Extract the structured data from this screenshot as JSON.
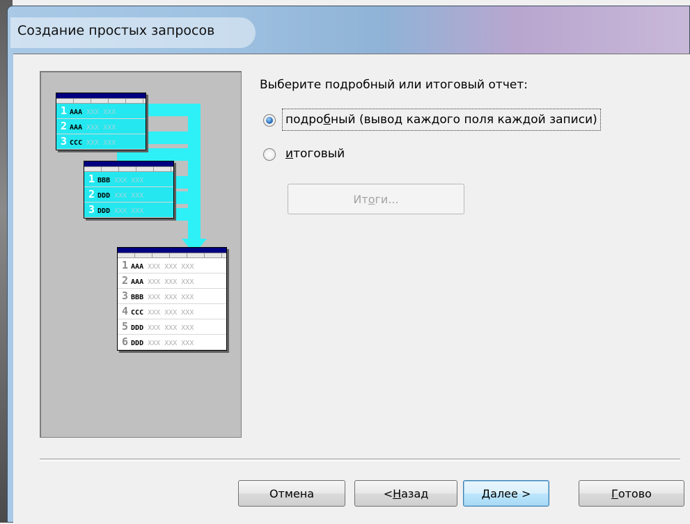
{
  "window": {
    "title": "Создание простых запросов"
  },
  "preview": {
    "table1": [
      {
        "n": "1",
        "k": "AAA",
        "x": "XXX XXX"
      },
      {
        "n": "2",
        "k": "AAA",
        "x": "XXX XXX"
      },
      {
        "n": "3",
        "k": "CCC",
        "x": "XXX XXX"
      }
    ],
    "table2": [
      {
        "n": "1",
        "k": "BBB",
        "x": "XXX XXX"
      },
      {
        "n": "2",
        "k": "DDD",
        "x": "XXX XXX"
      },
      {
        "n": "3",
        "k": "DDD",
        "x": "XXX XXX"
      }
    ],
    "table3": [
      {
        "n": "1",
        "k": "AAA",
        "x": "XXX XXX XXX"
      },
      {
        "n": "2",
        "k": "AAA",
        "x": "XXX XXX XXX"
      },
      {
        "n": "3",
        "k": "BBB",
        "x": "XXX XXX XXX"
      },
      {
        "n": "4",
        "k": "CCC",
        "x": "XXX XXX XXX"
      },
      {
        "n": "5",
        "k": "DDD",
        "x": "XXX XXX XXX"
      },
      {
        "n": "6",
        "k": "DDD",
        "x": "XXX XXX XXX"
      }
    ],
    "flow_color": "#2ef0f7"
  },
  "options": {
    "prompt": "Выберите подробный или итоговый отчет:",
    "detail": {
      "before": "подро",
      "accel": "б",
      "after": "ный (вывод каждого поля каждой записи)",
      "checked": true
    },
    "summary": {
      "before": "",
      "accel": "и",
      "after": "тоговый",
      "checked": false
    },
    "summary_button": {
      "before": "Ит",
      "accel": "о",
      "after": "ги...",
      "enabled": false
    }
  },
  "footer": {
    "cancel": {
      "before": "Отмена",
      "accel": "",
      "after": ""
    },
    "back": {
      "before": "< ",
      "accel": "Н",
      "after": "азад"
    },
    "next": {
      "before": "",
      "accel": "Д",
      "after": "алее >"
    },
    "finish": {
      "before": "",
      "accel": "Г",
      "after": "отово"
    }
  }
}
